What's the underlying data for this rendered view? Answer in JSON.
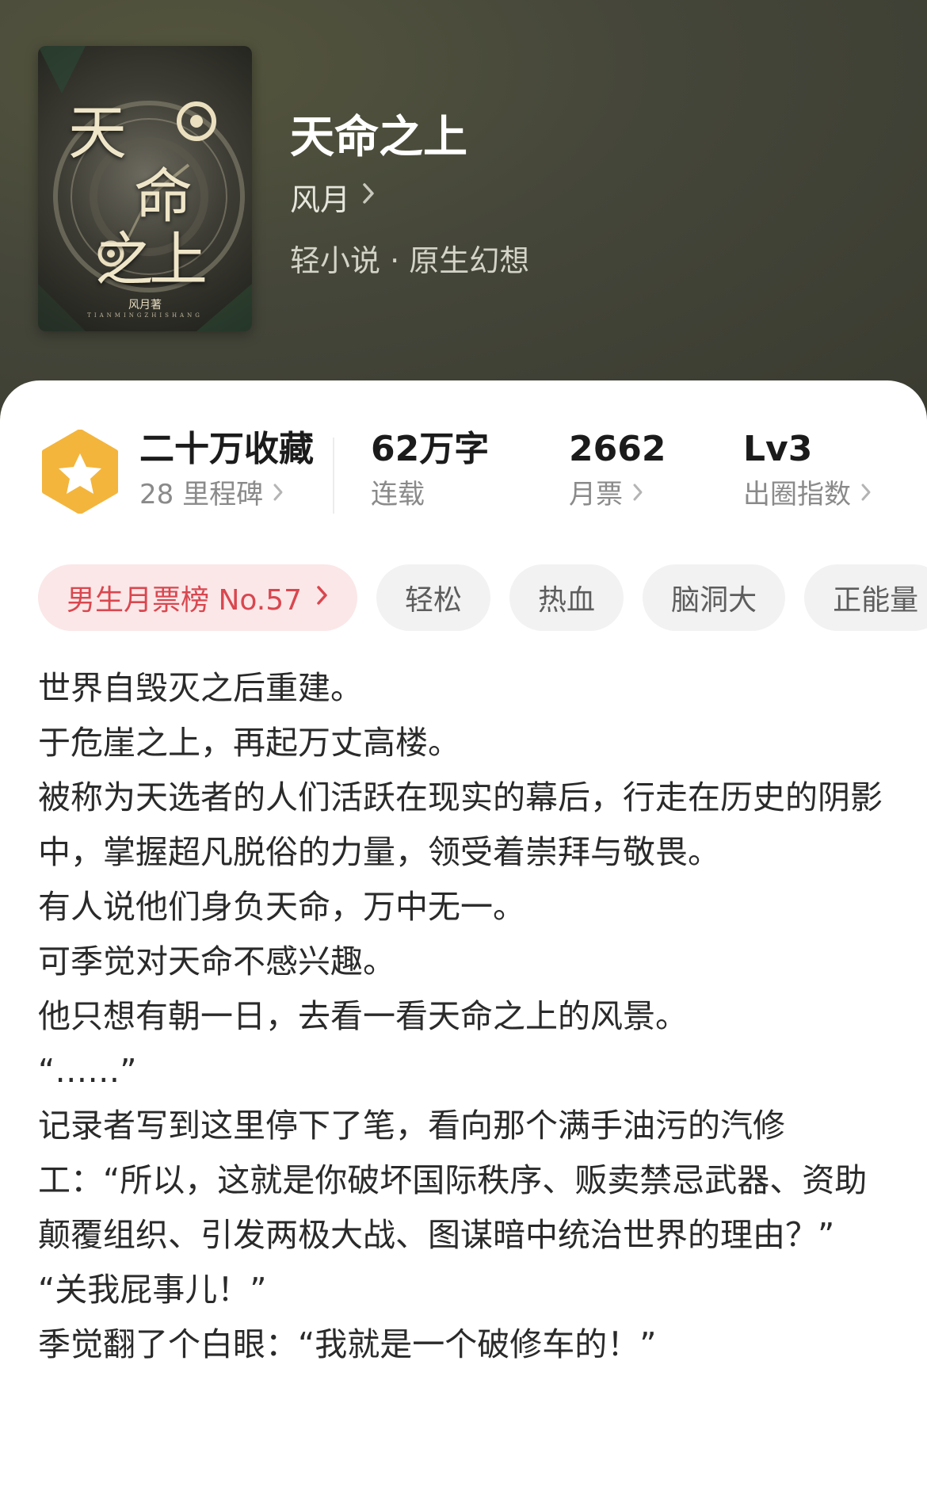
{
  "book": {
    "title": "天命之上",
    "author": "风月",
    "genre": "轻小说 · 原生幻想"
  },
  "cover": {
    "title_line1": "天",
    "title_line2": "命",
    "title_line3": "之上",
    "author": "风月著",
    "pinyin": "TIANMINGZHISHANG"
  },
  "stats": [
    {
      "big": "二十万收藏",
      "small": "28 里程碑"
    },
    {
      "big": "62万字",
      "small": "连载"
    },
    {
      "big": "2662",
      "small": "月票"
    },
    {
      "big": "Lv3",
      "small": "出圈指数"
    }
  ],
  "tags": {
    "rank": "男生月票榜 No.57",
    "items": [
      "轻松",
      "热血",
      "脑洞大",
      "正能量"
    ]
  },
  "description": [
    "世界自毁灭之后重建。",
    "于危崖之上，再起万丈高楼。",
    "被称为天选者的人们活跃在现实的幕后，行走在历史的阴影中，掌握超凡脱俗的力量，领受着崇拜与敬畏。",
    "有人说他们身负天命，万中无一。",
    "可季觉对天命不感兴趣。",
    "他只想有朝一日，去看一看天命之上的风景。",
    "“……”",
    "记录者写到这里停下了笔，看向那个满手油污的汽修工：“所以，这就是你破坏国际秩序、贩卖禁忌武器、资助颠覆组织、引发两极大战、图谋暗中统治世界的理由？”",
    "“关我屁事儿！”",
    "季觉翻了个白眼：“我就是一个破修车的！”"
  ],
  "icons": {
    "chevron": "chevron-right-icon",
    "badge": "star-badge-icon"
  },
  "colors": {
    "hero_bg": "#45463a",
    "badge": "#f3b53c",
    "rank_tag_bg": "#fbe7e8",
    "rank_tag_text": "#d9474f"
  }
}
